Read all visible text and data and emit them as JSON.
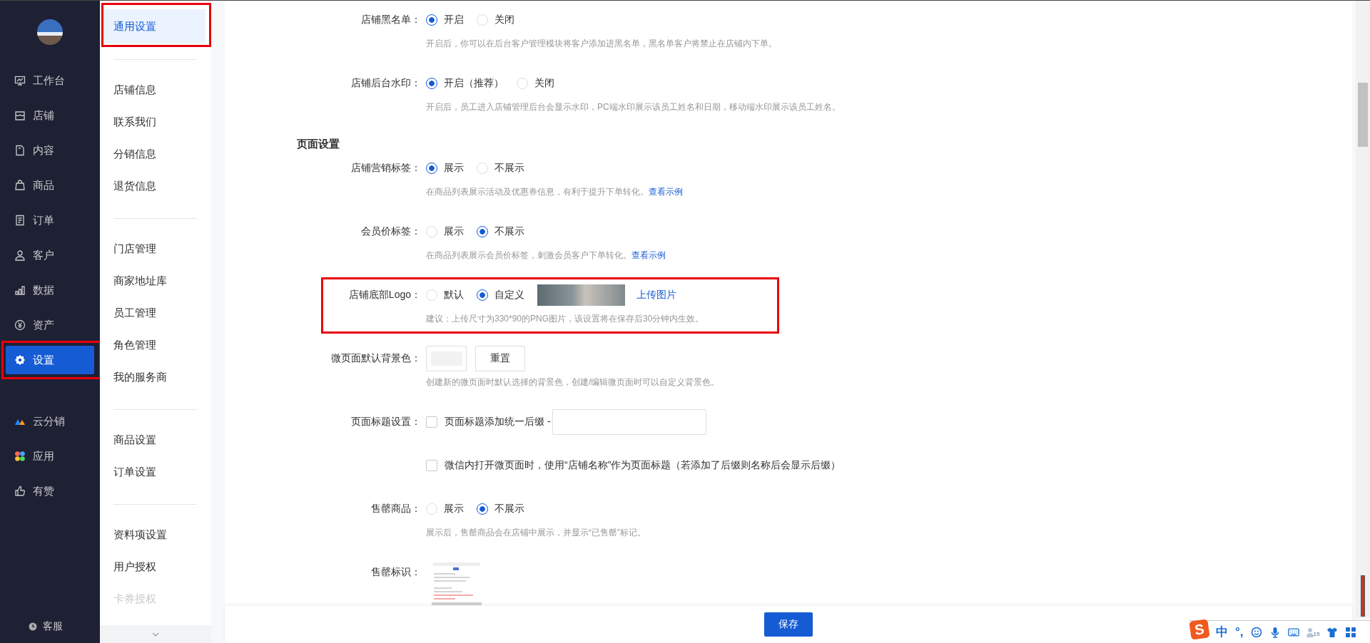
{
  "sidebar": {
    "groups": [
      [
        {
          "label": "工作台",
          "selected": false,
          "highlighted": false
        },
        {
          "label": "店铺",
          "selected": false,
          "highlighted": false
        },
        {
          "label": "内容",
          "selected": false,
          "highlighted": false
        },
        {
          "label": "商品",
          "selected": false,
          "highlighted": false
        },
        {
          "label": "订单",
          "selected": false,
          "highlighted": false
        },
        {
          "label": "客户",
          "selected": false,
          "highlighted": false
        },
        {
          "label": "数据",
          "selected": false,
          "highlighted": false
        },
        {
          "label": "资产",
          "selected": false,
          "highlighted": false
        },
        {
          "label": "设置",
          "selected": true,
          "highlighted": true
        }
      ],
      [
        {
          "label": "云分销",
          "selected": false,
          "highlighted": false
        },
        {
          "label": "应用",
          "selected": false,
          "highlighted": false
        },
        {
          "label": "有赞",
          "selected": false,
          "highlighted": false
        }
      ]
    ],
    "service": "客服"
  },
  "subnav": {
    "groups": [
      [
        {
          "label": "通用设置",
          "selected": true,
          "highlighted": true,
          "faded": false
        }
      ],
      [
        {
          "label": "店铺信息",
          "selected": false,
          "highlighted": false,
          "faded": false
        },
        {
          "label": "联系我们",
          "selected": false,
          "highlighted": false,
          "faded": false
        },
        {
          "label": "分销信息",
          "selected": false,
          "highlighted": false,
          "faded": false
        },
        {
          "label": "退货信息",
          "selected": false,
          "highlighted": false,
          "faded": false
        }
      ],
      [
        {
          "label": "门店管理",
          "selected": false,
          "highlighted": false,
          "faded": false
        },
        {
          "label": "商家地址库",
          "selected": false,
          "highlighted": false,
          "faded": false
        },
        {
          "label": "员工管理",
          "selected": false,
          "highlighted": false,
          "faded": false
        },
        {
          "label": "角色管理",
          "selected": false,
          "highlighted": false,
          "faded": false
        },
        {
          "label": "我的服务商",
          "selected": false,
          "highlighted": false,
          "faded": false
        }
      ],
      [
        {
          "label": "商品设置",
          "selected": false,
          "highlighted": false,
          "faded": false
        },
        {
          "label": "订单设置",
          "selected": false,
          "highlighted": false,
          "faded": false
        }
      ],
      [
        {
          "label": "资料项设置",
          "selected": false,
          "highlighted": false,
          "faded": false
        },
        {
          "label": "用户授权",
          "selected": false,
          "highlighted": false,
          "faded": false
        },
        {
          "label": "卡券授权",
          "selected": false,
          "highlighted": false,
          "faded": true
        }
      ]
    ]
  },
  "form": {
    "rows": [
      {
        "kind": "radio",
        "label": "店铺黑名单：",
        "highlighted": false,
        "options": [
          {
            "label": "开启",
            "selected": true
          },
          {
            "label": "关闭",
            "selected": false
          }
        ],
        "description": "开启后，你可以在后台客户管理模块将客户添加进黑名单，黑名单客户将禁止在店铺内下单。"
      },
      {
        "kind": "radio",
        "label": "店铺后台水印：",
        "highlighted": false,
        "options": [
          {
            "label": "开启（推荐）",
            "selected": true
          },
          {
            "label": "关闭",
            "selected": false
          }
        ],
        "description": "开启后，员工进入店铺管理后台会显示水印，PC端水印展示该员工姓名和日期，移动端水印展示该员工姓名。"
      },
      {
        "kind": "heading",
        "label": "页面设置",
        "highlighted": false
      },
      {
        "kind": "radio",
        "label": "店铺营销标签：",
        "highlighted": false,
        "options": [
          {
            "label": "展示",
            "selected": true
          },
          {
            "label": "不展示",
            "selected": false
          }
        ],
        "description": "在商品列表展示活动及优惠券信息，有利于提升下单转化。",
        "link": "查看示例"
      },
      {
        "kind": "radio",
        "label": "会员价标签：",
        "highlighted": false,
        "options": [
          {
            "label": "展示",
            "selected": false
          },
          {
            "label": "不展示",
            "selected": true
          }
        ],
        "description": "在商品列表展示会员价标签，刺激会员客户下单转化。",
        "link": "查看示例"
      },
      {
        "kind": "logo",
        "label": "店铺底部Logo：",
        "highlighted": true,
        "options": [
          {
            "label": "默认",
            "selected": false
          },
          {
            "label": "自定义",
            "selected": true
          }
        ],
        "upload": "上传图片",
        "description": "建议：上传尺寸为330*90的PNG图片，该设置将在保存后30分钟内生效。"
      },
      {
        "kind": "color",
        "label": "微页面默认背景色：",
        "highlighted": false,
        "button": "重置",
        "description": "创建新的微页面时默认选择的背景色，创建/编辑微页面时可以自定义背景色。"
      },
      {
        "kind": "checkbox",
        "label": "页面标题设置：",
        "highlighted": false,
        "text": "页面标题添加统一后缀 -",
        "checked": false,
        "input": true
      },
      {
        "kind": "checkbox",
        "highlighted": false,
        "text": "微信内打开微页面时，使用“店铺名称”作为页面标题（若添加了后缀则名称后会显示后缀）",
        "checked": false,
        "input": false
      },
      {
        "kind": "radio",
        "label": "售罄商品：",
        "highlighted": false,
        "options": [
          {
            "label": "展示",
            "selected": false
          },
          {
            "label": "不展示",
            "selected": true
          }
        ],
        "description": "展示后，售罄商品会在店铺中展示，并显示“已售罄”标记。"
      },
      {
        "kind": "image",
        "label": "售罄标识：",
        "highlighted": false
      }
    ]
  },
  "footer": {
    "save": "保存"
  },
  "ime_bar": {
    "logo": "S",
    "mode": "中",
    "punctuation": "°,",
    "badge": "15"
  }
}
